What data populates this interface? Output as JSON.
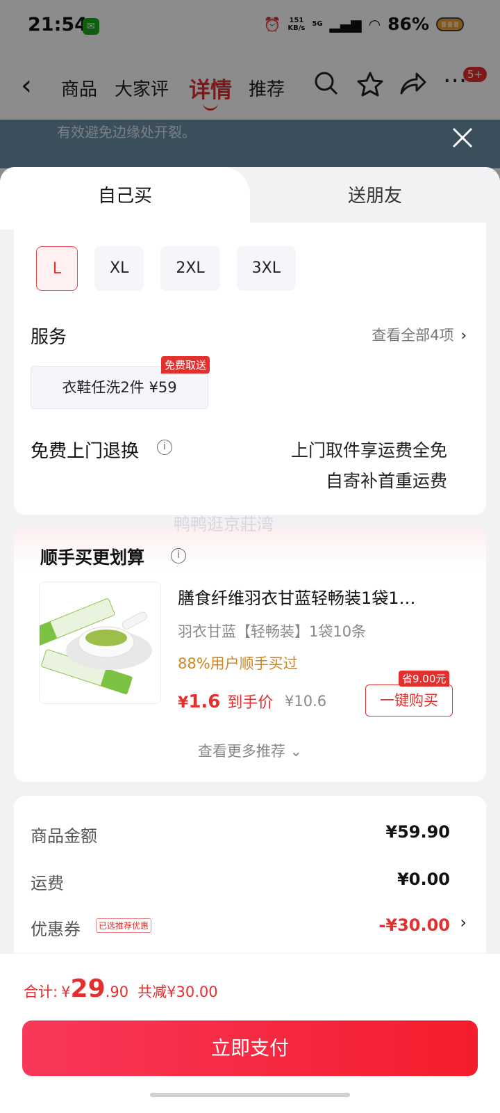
{
  "status_bar": {
    "time": "21:54",
    "net_speed_value": "151",
    "net_speed_unit": "KB/s",
    "network": "5G",
    "battery": "86%"
  },
  "nav": {
    "tabs": [
      "商品",
      "大家评",
      "详情",
      "推荐"
    ],
    "active_tab": "详情",
    "badge": "5+"
  },
  "background": {
    "hero_text": "有效避免边缘处开裂。"
  },
  "sheet_tabs": {
    "self": "自己买",
    "gift": "送朋友"
  },
  "sizes": {
    "options": [
      "L",
      "XL",
      "2XL",
      "3XL"
    ],
    "selected": "L"
  },
  "service": {
    "title": "服务",
    "view_all": "查看全部4项",
    "chip": "衣鞋任洗2件 ¥59",
    "chip_badge": "免费取送"
  },
  "returns": {
    "title": "免费上门退换",
    "line1": "上门取件享运费全免",
    "line2": "自寄补首重运费"
  },
  "watermark": "鸭鸭逛京莊湾",
  "recommend": {
    "title": "顺手买更划算",
    "product_name": "膳食纤维羽衣甘蓝轻畅装1袋1…",
    "spec": "羽衣甘蓝【轻畅装】1袋10条",
    "bought": "88%用户顺手买过",
    "price_symbol": "¥",
    "price": "1.6",
    "price_label": "到手价",
    "original_price": "¥10.6",
    "save_tag": "省9.00元",
    "buy_button": "一键购买",
    "more": "查看更多推荐 ⌄"
  },
  "summary": {
    "goods_label": "商品金额",
    "goods_value": "¥59.90",
    "shipping_label": "运费",
    "shipping_value": "¥0.00",
    "coupon_label": "优惠券",
    "coupon_tag": "已选推荐优惠",
    "coupon_value": "-¥30.00"
  },
  "footer": {
    "total_label": "合计:",
    "total_symbol": "¥",
    "total_int": "29",
    "total_dec": ".90",
    "reduced": "共减¥30.00",
    "pay_button": "立即支付"
  },
  "colors": {
    "accent": "#e3302e",
    "pay_gradient_start": "#f8385a",
    "pay_gradient_end": "#f51c2c",
    "discount_orange": "#d2851f"
  },
  "icons": [
    "back-icon",
    "search-icon",
    "star-icon",
    "share-icon",
    "more-icon",
    "close-icon",
    "info-icon",
    "chevron-right-icon"
  ]
}
